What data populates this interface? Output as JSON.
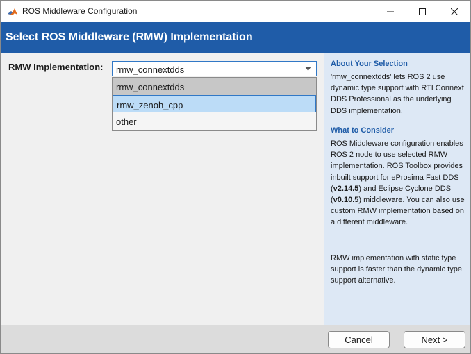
{
  "window": {
    "title": "ROS Middleware Configuration"
  },
  "banner": {
    "title": "Select ROS Middleware (RMW) Implementation"
  },
  "form": {
    "label": "RMW Implementation:",
    "selected": "rmw_connextdds",
    "options": [
      "rmw_connextdds",
      "rmw_zenoh_cpp",
      "other"
    ],
    "highlighted_option": "rmw_zenoh_cpp"
  },
  "sidebar": {
    "about_title": "About Your Selection",
    "about_lines": [
      "'rmw_connextdds' lets ROS 2 use",
      "dynamic type support with RTI Connext",
      "DDS Professional as the underlying",
      "DDS implementation."
    ],
    "consider_title": "What to Consider",
    "consider_lines": [
      "ROS Middleware configuration enables",
      "ROS 2 node to use selected RMW",
      "implementation. ROS Toolbox provides",
      "inbuilt support for eProsima Fast DDS"
    ],
    "fast_dds_version": "v2.14.5",
    "consider_text_2": ") and Eclipse Cyclone DDS",
    "cyclone_version": "v0.10.5",
    "consider_text_3": ") middleware. You can also use",
    "consider_lines_end": [
      "custom RMW implementation based on",
      "a different middleware."
    ],
    "note_lines": [
      "RMW implementation with static type",
      "support is faster than the dynamic type",
      "support alternative."
    ]
  },
  "footer": {
    "cancel_label": "Cancel",
    "next_label": "Next >"
  },
  "colors": {
    "banner": "#1f5ca8",
    "sidebar": "#dde8f5",
    "highlight": "#bcdcf7",
    "accent": "#3178c6"
  },
  "icons": [
    "matlab-icon",
    "minimize-icon",
    "maximize-icon",
    "close-icon",
    "chevron-down-icon"
  ]
}
